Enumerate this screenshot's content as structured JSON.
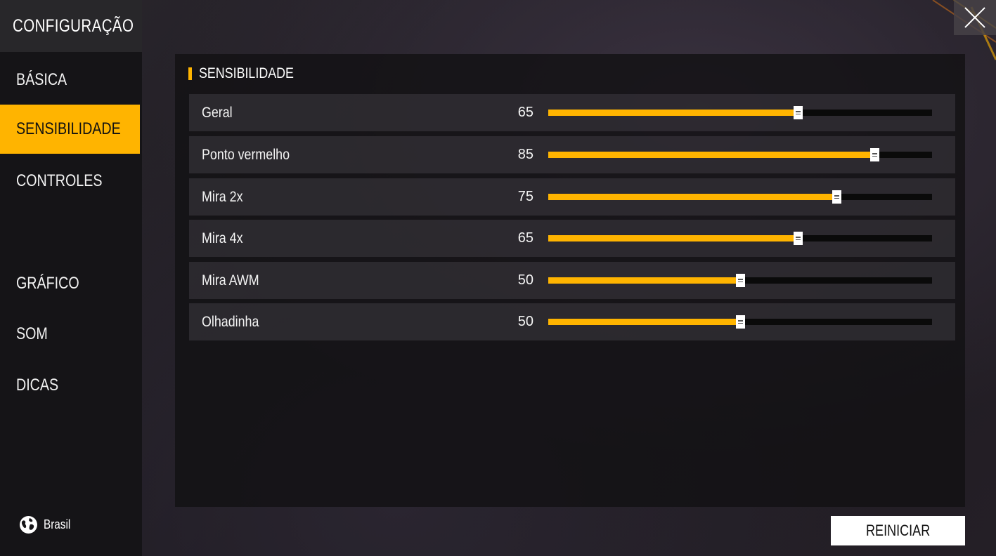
{
  "sidebar": {
    "title": "CONFIGURAÇÃO",
    "items": [
      {
        "label": "BÁSICA",
        "active": false
      },
      {
        "label": "SENSIBILIDADE",
        "active": true
      },
      {
        "label": "CONTROLES",
        "active": false
      },
      {
        "label": "GRÁFICO",
        "active": false
      },
      {
        "label": "SOM",
        "active": false
      },
      {
        "label": "DICAS",
        "active": false
      }
    ],
    "region": {
      "label": "Brasil",
      "icon": "globe-icon"
    }
  },
  "section": {
    "title": "SENSIBILIDADE",
    "sliders": [
      {
        "label": "Geral",
        "value": "65",
        "level": 65
      },
      {
        "label": "Ponto vermelho",
        "value": "85",
        "level": 85
      },
      {
        "label": "Mira 2x",
        "value": "75",
        "level": 75
      },
      {
        "label": "Mira 4x",
        "value": "65",
        "level": 65
      },
      {
        "label": "Mira AWM",
        "value": "50",
        "level": 50
      },
      {
        "label": "Olhadinha",
        "value": "50",
        "level": 50
      }
    ],
    "slider_max": 100
  },
  "actions": {
    "reset_label": "REINICIAR",
    "close_icon": "close-icon"
  },
  "colors": {
    "accent": "#ffb400",
    "track": "#0a0a0a",
    "sidebar": "#151417"
  }
}
